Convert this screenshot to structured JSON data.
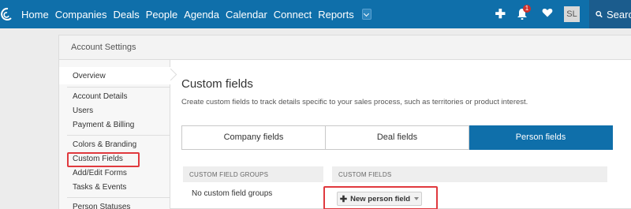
{
  "nav": {
    "items": [
      "Home",
      "Companies",
      "Deals",
      "People",
      "Agenda",
      "Calendar",
      "Connect",
      "Reports"
    ],
    "notification_count": "1",
    "avatar_initials": "SL",
    "search_label": "Search"
  },
  "panel": {
    "title": "Account Settings",
    "sidebar": {
      "overview": "Overview",
      "account_details": "Account Details",
      "users": "Users",
      "payment_billing": "Payment & Billing",
      "colors_branding": "Colors & Branding",
      "custom_fields": "Custom Fields",
      "add_edit_forms": "Add/Edit Forms",
      "tasks_events": "Tasks & Events",
      "person_statuses": "Person Statuses"
    },
    "content": {
      "title": "Custom fields",
      "subtitle": "Create custom fields to track details specific to your sales process, such as territories or product interest.",
      "tabs": [
        "Company fields",
        "Deal fields",
        "Person fields"
      ],
      "active_tab": "Person fields",
      "groups_header": "CUSTOM FIELD GROUPS",
      "fields_header": "CUSTOM FIELDS",
      "no_groups": "No custom field groups",
      "new_field_button": "New person field"
    }
  },
  "colors": {
    "brand_blue": "#0f6faa",
    "highlight_red": "#e0393e",
    "badge_red": "#d0312d"
  }
}
